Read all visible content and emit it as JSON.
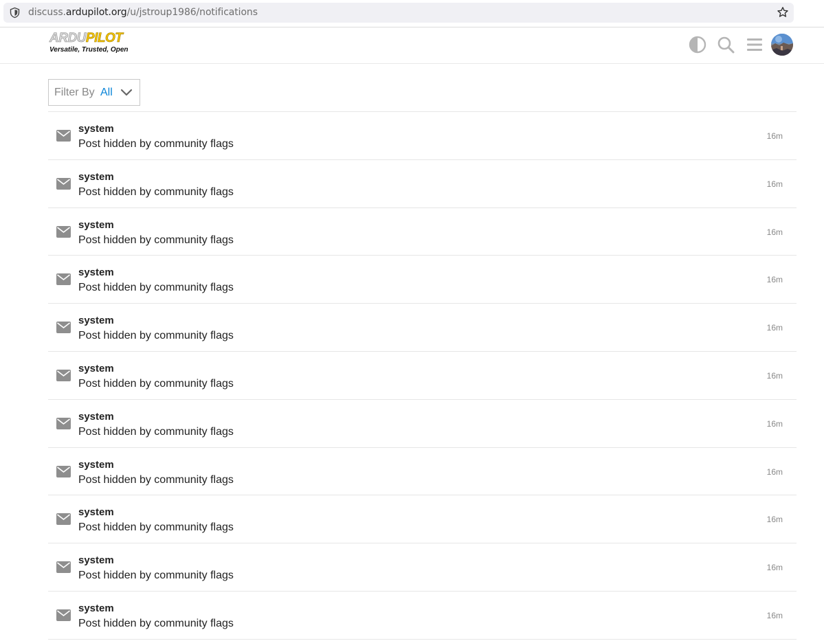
{
  "browser": {
    "url_prefix": "discuss.",
    "url_host": "ardupilot.org",
    "url_path": "/u/jstroup1986/notifications"
  },
  "header": {
    "logo_word_ardu": "ARDU",
    "logo_word_pilot": "PILOT",
    "logo_tagline": "Versatile, Trusted, Open",
    "icons": [
      "theme-toggle-icon",
      "search-icon",
      "hamburger-menu-icon",
      "user-avatar"
    ]
  },
  "filter": {
    "label": "Filter By",
    "value": "All"
  },
  "colors": {
    "accent": "#0a84d8",
    "icon_gray": "#8e8e8e"
  },
  "notifications": [
    {
      "user": "system",
      "text": "Post hidden by community flags",
      "time": "16m"
    },
    {
      "user": "system",
      "text": "Post hidden by community flags",
      "time": "16m"
    },
    {
      "user": "system",
      "text": "Post hidden by community flags",
      "time": "16m"
    },
    {
      "user": "system",
      "text": "Post hidden by community flags",
      "time": "16m"
    },
    {
      "user": "system",
      "text": "Post hidden by community flags",
      "time": "16m"
    },
    {
      "user": "system",
      "text": "Post hidden by community flags",
      "time": "16m"
    },
    {
      "user": "system",
      "text": "Post hidden by community flags",
      "time": "16m"
    },
    {
      "user": "system",
      "text": "Post hidden by community flags",
      "time": "16m"
    },
    {
      "user": "system",
      "text": "Post hidden by community flags",
      "time": "16m"
    },
    {
      "user": "system",
      "text": "Post hidden by community flags",
      "time": "16m"
    },
    {
      "user": "system",
      "text": "Post hidden by community flags",
      "time": "16m"
    }
  ]
}
